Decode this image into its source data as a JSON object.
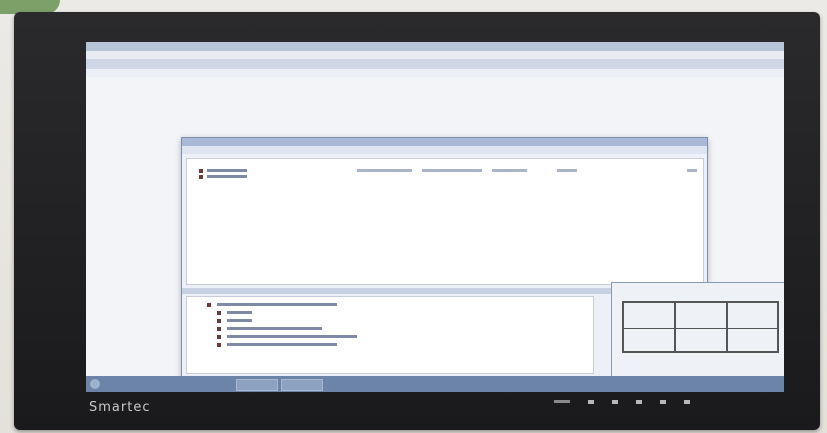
{
  "monitor": {
    "brand": "Smartec"
  },
  "screen": {
    "dialog_rows": [
      {
        "text": "",
        "cols": [
          "",
          "",
          "",
          ""
        ]
      },
      {
        "text": "",
        "cols": [
          "",
          "",
          "",
          ""
        ]
      }
    ],
    "tree_items": [
      "",
      "",
      "",
      "",
      "",
      ""
    ]
  },
  "colors": {
    "bezel": "#1f1f21",
    "screen_bg": "#d9dde9",
    "titlebar": "#a9b9d6",
    "taskbar": "#6c84a8"
  }
}
